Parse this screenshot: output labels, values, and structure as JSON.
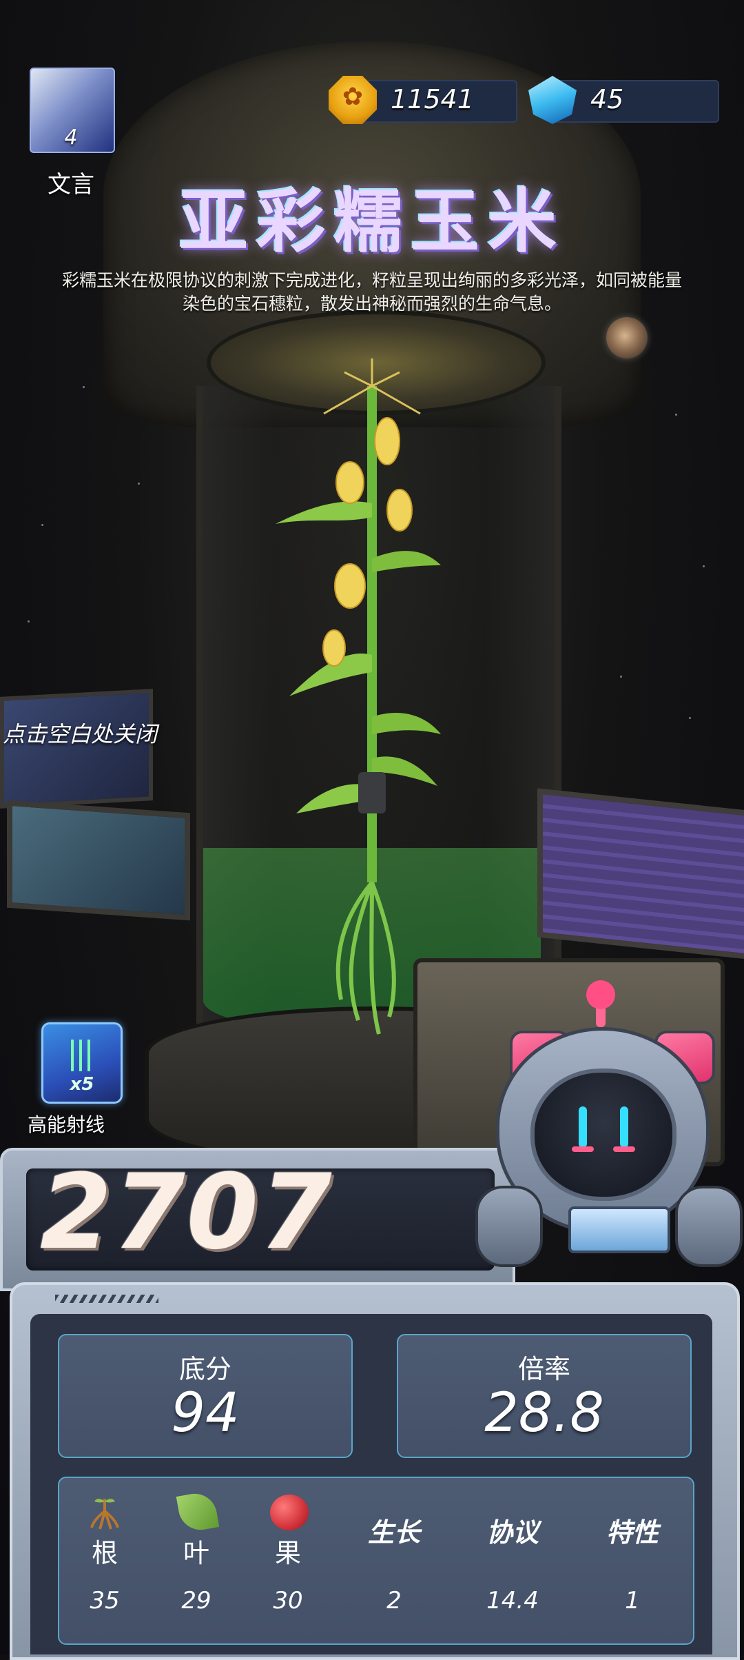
{
  "player": {
    "name": "文言",
    "level": "4"
  },
  "currency": {
    "coins": "11541",
    "gems": "45",
    "coin_icon": "coin-icon",
    "gem_icon": "gem-icon"
  },
  "plant": {
    "title": "亚彩糯玉米",
    "description": "彩糯玉米在极限协议的刺激下完成进化，籽粒呈现出绚丽的多彩光泽，如同被能量染色的宝石穗粒，散发出神秘而强烈的生命气息。"
  },
  "hint": {
    "close_text": "点击空白处关闭"
  },
  "skill": {
    "label": "高能射线",
    "multiplier": "x5",
    "icon": "energy-ray-icon"
  },
  "score": {
    "total": "2707",
    "base_label": "底分",
    "base_value": "94",
    "rate_label": "倍率",
    "rate_value": "28.8"
  },
  "details": [
    {
      "label": "根",
      "value": "35",
      "icon": "root-icon"
    },
    {
      "label": "叶",
      "value": "29",
      "icon": "leaf-icon"
    },
    {
      "label": "果",
      "value": "30",
      "icon": "apple-icon"
    },
    {
      "label": "生长",
      "value": "2",
      "icon": ""
    },
    {
      "label": "协议",
      "value": "14.4",
      "icon": ""
    },
    {
      "label": "特性",
      "value": "1",
      "icon": ""
    }
  ],
  "colors": {
    "title_glow": "#9de6ff",
    "panel_border": "#5aa5c9",
    "robot_accent": "#ff4f84",
    "liquid": "#3a9a4a"
  }
}
